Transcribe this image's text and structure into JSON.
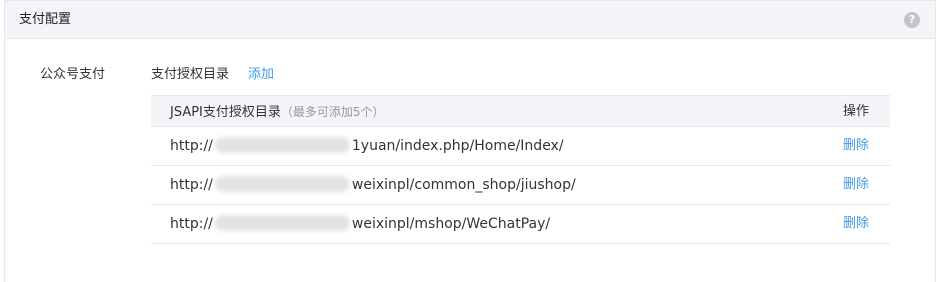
{
  "panel": {
    "title": "支付配置",
    "help_icon": "?"
  },
  "section": {
    "label": "公众号支付",
    "subtitle": "支付授权目录",
    "add_link": "添加"
  },
  "table": {
    "header_directory": "JSAPI支付授权目录",
    "header_note": "（最多可添加5个）",
    "header_action": "操作",
    "rows": [
      {
        "prefix": "http://",
        "suffix": "1yuan/index.php/Home/Index/",
        "action": "删除"
      },
      {
        "prefix": "http://",
        "suffix": "weixinpl/common_shop/jiushop/",
        "action": "删除"
      },
      {
        "prefix": "http://",
        "suffix": "weixinpl/mshop/WeChatPay/",
        "action": "删除"
      }
    ]
  }
}
